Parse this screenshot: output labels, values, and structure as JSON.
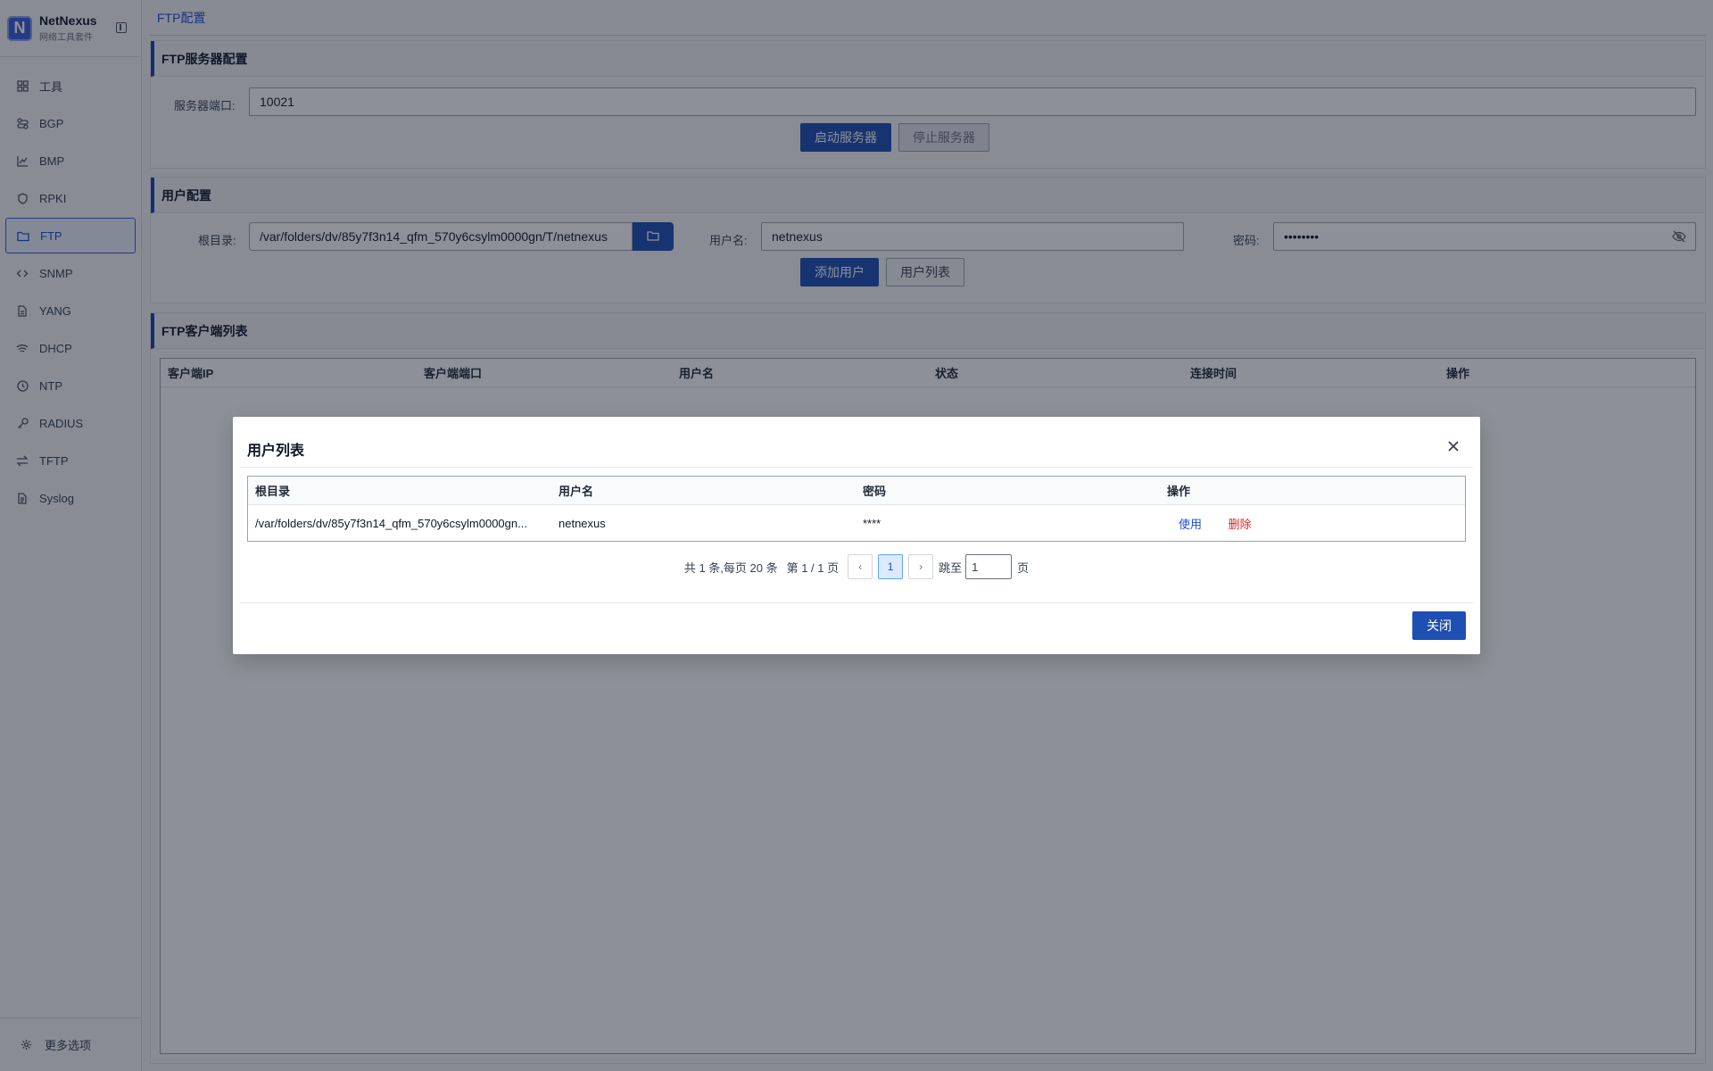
{
  "sidebar": {
    "brand_name": "NetNexus",
    "brand_sub": "网络工具套件",
    "logo_letter": "N",
    "items": [
      {
        "label": "工具",
        "icon": "grid-icon"
      },
      {
        "label": "BGP",
        "icon": "route-icon"
      },
      {
        "label": "BMP",
        "icon": "chart-icon"
      },
      {
        "label": "RPKI",
        "icon": "shield-icon"
      },
      {
        "label": "FTP",
        "icon": "folder-icon",
        "active": true
      },
      {
        "label": "SNMP",
        "icon": "code-icon"
      },
      {
        "label": "YANG",
        "icon": "file-icon"
      },
      {
        "label": "DHCP",
        "icon": "wifi-icon"
      },
      {
        "label": "NTP",
        "icon": "clock-icon"
      },
      {
        "label": "RADIUS",
        "icon": "key-icon"
      },
      {
        "label": "TFTP",
        "icon": "transfer-icon"
      },
      {
        "label": "Syslog",
        "icon": "document-icon"
      }
    ],
    "footer_label": "更多选项"
  },
  "tab": {
    "label": "FTP配置"
  },
  "server_card": {
    "title": "FTP服务器配置",
    "port_label": "服务器端口:",
    "port_value": "10021",
    "start_label": "启动服务器",
    "stop_label": "停止服务器"
  },
  "user_card": {
    "title": "用户配置",
    "root_label": "根目录:",
    "root_value": "/var/folders/dv/85y7f3n14_qfm_570y6csylm0000gn/T/netnexus",
    "username_label": "用户名:",
    "username_value": "netnexus",
    "password_label": "密码:",
    "password_value": "••••••••",
    "add_label": "添加用户",
    "list_label": "用户列表"
  },
  "client_card": {
    "title": "FTP客户端列表",
    "columns": [
      "客户端IP",
      "客户端端口",
      "用户名",
      "状态",
      "连接时间",
      "操作"
    ]
  },
  "modal": {
    "title": "用户列表",
    "columns": [
      "根目录",
      "用户名",
      "密码",
      "操作"
    ],
    "rows": [
      {
        "root": "/var/folders/dv/85y7f3n14_qfm_570y6csylm0000gn...",
        "username": "netnexus",
        "password": "****",
        "use": "使用",
        "delete": "删除"
      }
    ],
    "pager": {
      "summary": "共 1 条,每页 20 条",
      "page_info": "第 1 / 1 页",
      "prev": "‹",
      "current": "1",
      "next": "›",
      "jump_label": "跳至",
      "jump_value": "1",
      "page_suffix": "页"
    },
    "close_label": "关闭"
  }
}
